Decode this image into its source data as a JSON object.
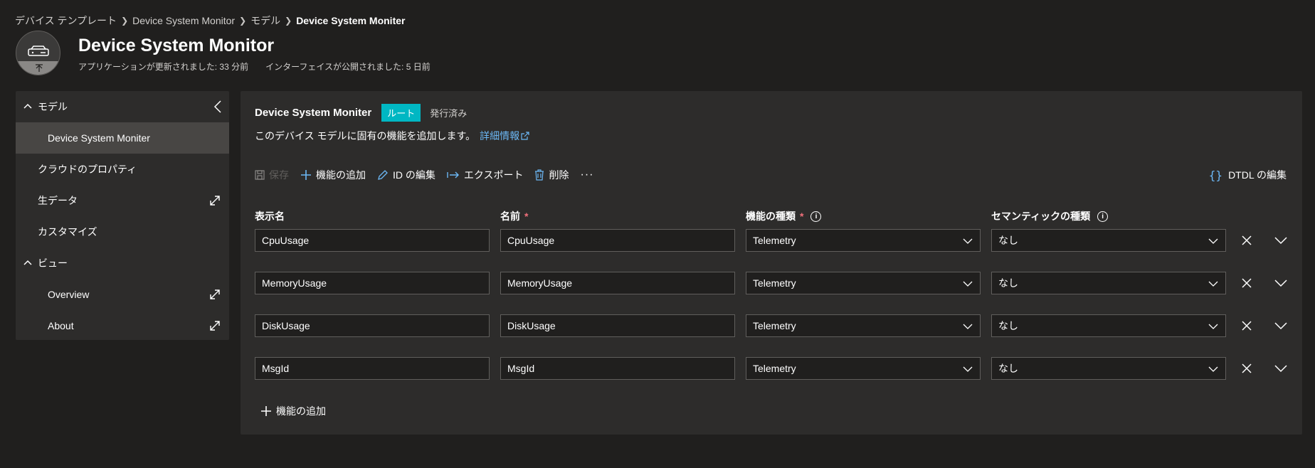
{
  "breadcrumb": {
    "items": [
      "デバイス テンプレート",
      "Device System Monitor",
      "モデル"
    ],
    "current": "Device System Moniter"
  },
  "device": {
    "title": "Device System Monitor",
    "updated": "アプリケーションが更新されました: 33 分前",
    "published": "インターフェイスが公開されました: 5 日前"
  },
  "nav": {
    "model_label": "モデル",
    "model_item": "Device System Moniter",
    "cloud_props": "クラウドのプロパティ",
    "raw_data": "生データ",
    "customize": "カスタマイズ",
    "views_label": "ビュー",
    "view_items": [
      "Overview",
      "About"
    ]
  },
  "model": {
    "name": "Device System Moniter",
    "badge": "ルート",
    "status": "発行済み",
    "description": "このデバイス モデルに固有の機能を追加します。",
    "learn_more": "詳細情報"
  },
  "toolbar": {
    "save": "保存",
    "add_capability": "機能の追加",
    "edit_id": "ID の編集",
    "export": "エクスポート",
    "delete": "削除",
    "more": "···",
    "edit_dtdl": "DTDL の編集"
  },
  "table": {
    "headers": {
      "display_name": "表示名",
      "name": "名前",
      "capability_type": "機能の種類",
      "semantic_type": "セマンティックの種類",
      "required_mark": "*",
      "info_mark": "i"
    },
    "rows": [
      {
        "display_name": "CpuUsage",
        "name": "CpuUsage",
        "capability_type": "Telemetry",
        "semantic_type": "なし"
      },
      {
        "display_name": "MemoryUsage",
        "name": "MemoryUsage",
        "capability_type": "Telemetry",
        "semantic_type": "なし"
      },
      {
        "display_name": "DiskUsage",
        "name": "DiskUsage",
        "capability_type": "Telemetry",
        "semantic_type": "なし"
      },
      {
        "display_name": "MsgId",
        "name": "MsgId",
        "capability_type": "Telemetry",
        "semantic_type": "なし"
      }
    ]
  },
  "footer": {
    "add_capability": "機能の追加"
  },
  "colors": {
    "background": "#201f1e",
    "panel": "#2d2c2b",
    "accent": "#00b7c3",
    "link": "#6cb8f6",
    "required": "#f1707b"
  }
}
